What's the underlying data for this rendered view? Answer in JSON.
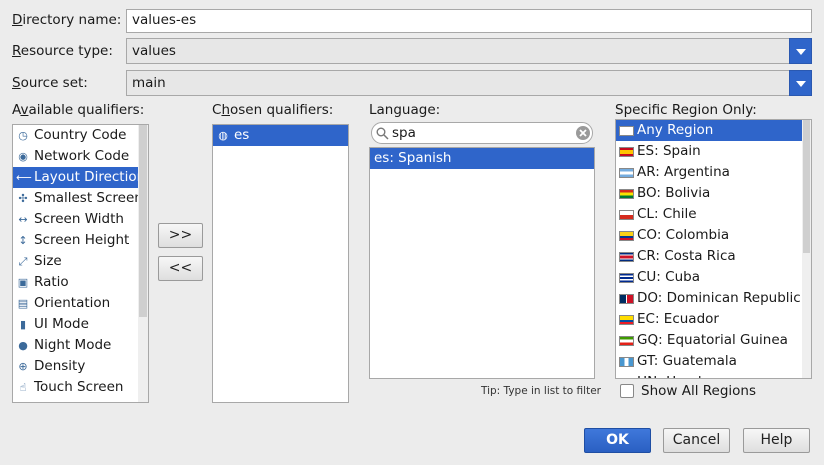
{
  "directory": {
    "label_mn": "D",
    "label_rest": "irectory name:",
    "value": "values-es"
  },
  "resource_type": {
    "label_mn": "R",
    "label_rest": "esource type:",
    "value": "values"
  },
  "source_set": {
    "label_mn": "S",
    "label_rest": "ource set:",
    "value": "main"
  },
  "available": {
    "label_a": "A",
    "label_mn": "v",
    "label_rest": "ailable qualifiers:",
    "items": [
      {
        "label": "Country Code",
        "icon": "country-code-icon",
        "selected": false
      },
      {
        "label": "Network Code",
        "icon": "network-code-icon",
        "selected": false
      },
      {
        "label": "Layout Direction",
        "icon": "layout-direction-icon",
        "selected": true
      },
      {
        "label": "Smallest Screen Width",
        "icon": "smallest-screen-icon",
        "selected": false
      },
      {
        "label": "Screen Width",
        "icon": "screen-width-icon",
        "selected": false
      },
      {
        "label": "Screen Height",
        "icon": "screen-height-icon",
        "selected": false
      },
      {
        "label": "Size",
        "icon": "size-icon",
        "selected": false
      },
      {
        "label": "Ratio",
        "icon": "ratio-icon",
        "selected": false
      },
      {
        "label": "Orientation",
        "icon": "orientation-icon",
        "selected": false
      },
      {
        "label": "UI Mode",
        "icon": "ui-mode-icon",
        "selected": false
      },
      {
        "label": "Night Mode",
        "icon": "night-mode-icon",
        "selected": false
      },
      {
        "label": "Density",
        "icon": "density-icon",
        "selected": false
      },
      {
        "label": "Touch Screen",
        "icon": "touch-screen-icon",
        "selected": false
      }
    ]
  },
  "buttons": {
    "add": ">>",
    "remove": "<<",
    "ok": "OK",
    "cancel": "Cancel",
    "help": "Help"
  },
  "chosen": {
    "label_c": "C",
    "label_mn": "h",
    "label_rest": "osen qualifiers:",
    "items": [
      {
        "label": "es",
        "icon": "globe-icon",
        "selected": true
      }
    ]
  },
  "language": {
    "label": "Language:",
    "search_value": "spa",
    "items": [
      {
        "label": "es: Spanish",
        "selected": true
      }
    ],
    "tip": "Tip: Type in list to filter"
  },
  "region": {
    "label": "Specific Region Only:",
    "items": [
      {
        "label": "Any Region",
        "flag": "blank",
        "selected": true
      },
      {
        "label": "ES: Spain",
        "flag": "es",
        "selected": false
      },
      {
        "label": "AR: Argentina",
        "flag": "ar",
        "selected": false
      },
      {
        "label": "BO: Bolivia",
        "flag": "bo",
        "selected": false
      },
      {
        "label": "CL: Chile",
        "flag": "cl",
        "selected": false
      },
      {
        "label": "CO: Colombia",
        "flag": "co",
        "selected": false
      },
      {
        "label": "CR: Costa Rica",
        "flag": "cr",
        "selected": false
      },
      {
        "label": "CU: Cuba",
        "flag": "cu",
        "selected": false
      },
      {
        "label": "DO: Dominican Republic",
        "flag": "do",
        "selected": false
      },
      {
        "label": "EC: Ecuador",
        "flag": "ec",
        "selected": false
      },
      {
        "label": "GQ: Equatorial Guinea",
        "flag": "gq",
        "selected": false
      },
      {
        "label": "GT: Guatemala",
        "flag": "gt",
        "selected": false
      },
      {
        "label": "HN: Honduras",
        "flag": "hn",
        "selected": false
      }
    ],
    "show_all_label": "Show All Regions",
    "show_all_checked": false
  }
}
